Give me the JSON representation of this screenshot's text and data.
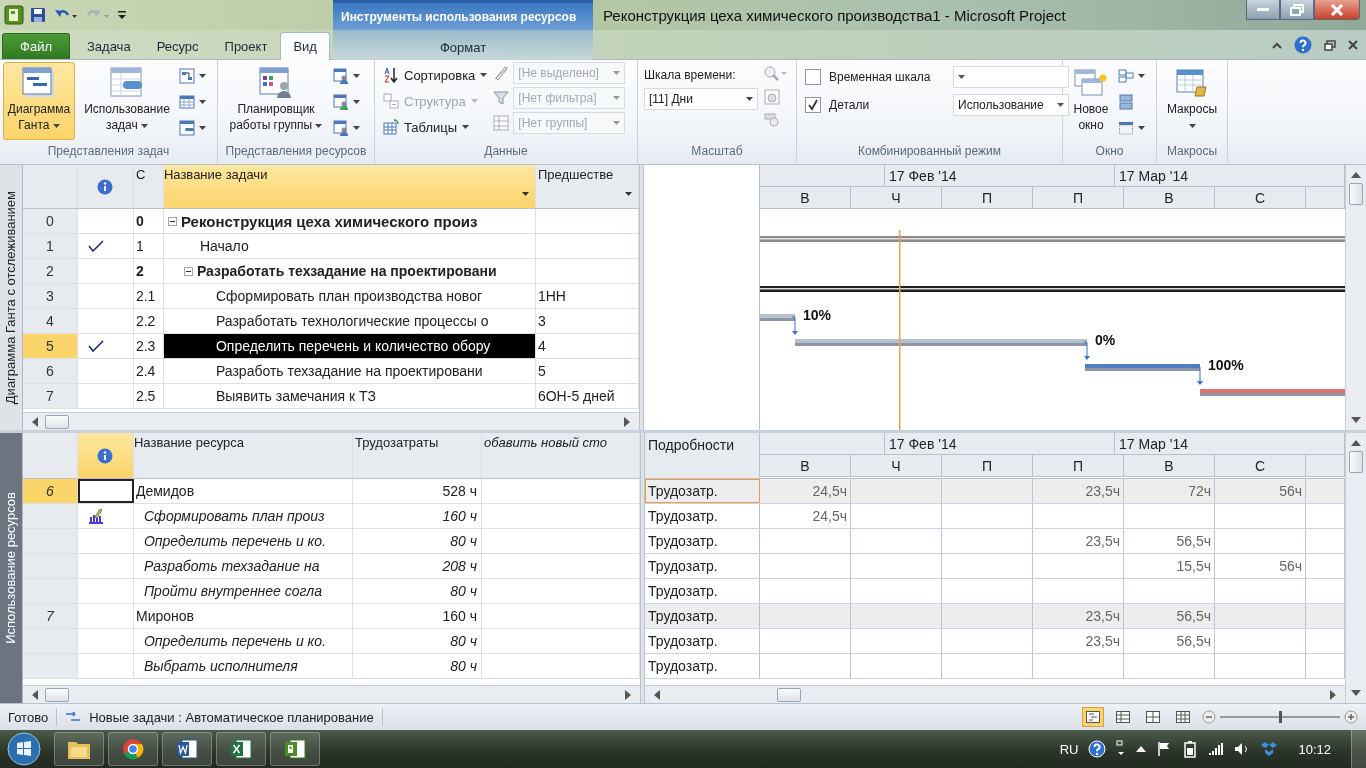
{
  "title_bar": {
    "context_group": "Инструменты использования ресурсов",
    "title": "Реконструкция цеха химического производства1  -  Microsoft Project"
  },
  "tabs": [
    {
      "label": "Файл",
      "kind": "file",
      "selected": false
    },
    {
      "label": "Задача",
      "kind": "tab",
      "selected": false
    },
    {
      "label": "Ресурс",
      "kind": "tab",
      "selected": false
    },
    {
      "label": "Проект",
      "kind": "tab",
      "selected": false
    },
    {
      "label": "Вид",
      "kind": "tab",
      "selected": true
    },
    {
      "label": "Формат",
      "kind": "context",
      "selected": false
    }
  ],
  "ribbon": {
    "task_views": {
      "label": "Представления задач",
      "buttons": [
        {
          "label": "Диаграмма Ганта",
          "selected": true
        },
        {
          "label": "Использование задач",
          "selected": false
        }
      ]
    },
    "resource_views": {
      "label": "Представления ресурсов",
      "button": "Планировщик работы группы"
    },
    "data": {
      "label": "Данные",
      "commands": [
        {
          "label": "Сортировка",
          "disabled": false
        },
        {
          "label": "Структура",
          "disabled": true
        },
        {
          "label": "Таблицы",
          "disabled": false
        }
      ],
      "combos": [
        "[Не выделено]",
        "[Нет фильтра]",
        "[Нет группы]"
      ]
    },
    "zoom": {
      "label": "Масштаб",
      "timescale_label": "Шкала времени:",
      "timescale_value": "[11] Дни"
    },
    "split": {
      "label": "Комбинированный режим",
      "options": [
        {
          "label": "Временная шкала",
          "checked": false
        },
        {
          "label": "Детали",
          "checked": true,
          "value": "Использование"
        }
      ]
    },
    "window": {
      "label": "Окно",
      "button": "Новое окно"
    },
    "macros": {
      "label": "Макросы",
      "button": "Макросы"
    }
  },
  "task_table": {
    "side_label": "Диаграмма Ганта с отслеживанием",
    "columns": [
      "С",
      "Название задачи",
      "Предшестве"
    ],
    "rows": [
      {
        "id": "0",
        "wbs": "0",
        "name": "Реконструкция цеха химического произ",
        "kind": "summary",
        "expanded": true,
        "done": false,
        "selected": false,
        "children": [
          {
            "id": "1",
            "wbs": "1",
            "name": "Начало",
            "kind": "task",
            "done": true,
            "selected": false
          },
          {
            "id": "2",
            "wbs": "2",
            "name": "Разработать техзадание на проектировани",
            "kind": "summary",
            "expanded": true,
            "done": false,
            "selected": false,
            "children": [
              {
                "id": "3",
                "wbs": "2.1",
                "name": "Сформировать план производства новог",
                "predecessors": "1НН",
                "bar_label": "10%",
                "kind": "task",
                "done": false,
                "selected": false
              },
              {
                "id": "4",
                "wbs": "2.2",
                "name": "Разработать технологические процессы о",
                "predecessors": "3",
                "bar_label": "0%",
                "kind": "task",
                "done": false,
                "selected": false
              },
              {
                "id": "5",
                "wbs": "2.3",
                "name": "Определить перечень и количество обору",
                "predecessors": "4",
                "bar_label": "100%",
                "kind": "task",
                "done": true,
                "selected": true
              },
              {
                "id": "6",
                "wbs": "2.4",
                "name": "Разработь техзадание на проектировани",
                "predecessors": "5",
                "kind": "task",
                "done": false,
                "selected": false
              },
              {
                "id": "7",
                "wbs": "2.5",
                "name": "Выявить замечания к ТЗ",
                "predecessors": "6ОН-5 дней",
                "kind": "task",
                "done": false,
                "selected": false
              }
            ]
          }
        ]
      }
    ]
  },
  "gantt": {
    "timescale": {
      "top": [
        "17 Фев '14",
        "17 Мар '14"
      ],
      "bottom": [
        "В",
        "Ч",
        "П",
        "П",
        "В",
        "С"
      ]
    }
  },
  "resource_table": {
    "side_label": "Использование ресурсов",
    "columns": [
      "Название ресурса",
      "Трудозатраты",
      "обавить новый сто"
    ],
    "rows": [
      {
        "id": "6",
        "name": "Демидов",
        "work": "528 ч",
        "selected": true,
        "detail": "Трудозатр.",
        "values": {
          "column_1": "24,5ч",
          "column_4": "23,5ч",
          "column_5": "72ч",
          "column_6": "56ч"
        },
        "children": [
          {
            "name": "Сформировать план произ",
            "work": "160 ч",
            "indicator": true,
            "detail": "Трудозатр.",
            "values": {
              "column_1": "24,5ч"
            }
          },
          {
            "name": "Определить перечень и ко.",
            "work": "80 ч",
            "indicator": false,
            "detail": "Трудозатр.",
            "values": {
              "column_4": "23,5ч",
              "column_5": "56,5ч"
            }
          },
          {
            "name": "Разработь техзадание на",
            "work": "208 ч",
            "indicator": false,
            "detail": "Трудозатр.",
            "values": {
              "column_5": "15,5ч",
              "column_6": "56ч"
            }
          },
          {
            "name": "Пройти внутреннее согла",
            "work": "80 ч",
            "indicator": false,
            "detail": "Трудозатр."
          }
        ]
      },
      {
        "id": "7",
        "name": "Миронов",
        "work": "160 ч",
        "selected": false,
        "detail": "Трудозатр.",
        "values": {
          "column_4": "23,5ч",
          "column_5": "56,5ч"
        },
        "children": [
          {
            "name": "Определить перечень и ко.",
            "work": "80 ч",
            "indicator": false,
            "detail": "Трудозатр.",
            "values": {
              "column_4": "23,5ч",
              "column_5": "56,5ч"
            }
          },
          {
            "name": "Выбрать исполнителя",
            "work": "80 ч",
            "indicator": false,
            "detail": "Трудозатр."
          }
        ]
      }
    ]
  },
  "usage": {
    "details_header": "Подробности",
    "timescale": {
      "top": [
        "17 Фев '14",
        "17 Мар '14"
      ],
      "bottom": [
        "В",
        "Ч",
        "П",
        "П",
        "В",
        "С"
      ]
    }
  },
  "status_bar": {
    "ready": "Готово",
    "new_tasks": "Новые задачи : Автоматическое планирование",
    "view_buttons": [
      {
        "selected": true
      },
      {
        "selected": false
      },
      {
        "selected": false
      },
      {
        "selected": false
      }
    ],
    "zoom": {
      "level": 0.5
    }
  },
  "taskbar": {
    "apps": [
      {
        "kind": "explorer"
      },
      {
        "kind": "chrome"
      },
      {
        "kind": "word"
      },
      {
        "kind": "excel"
      },
      {
        "kind": "project"
      }
    ],
    "language": "RU",
    "clock": "10:12"
  }
}
